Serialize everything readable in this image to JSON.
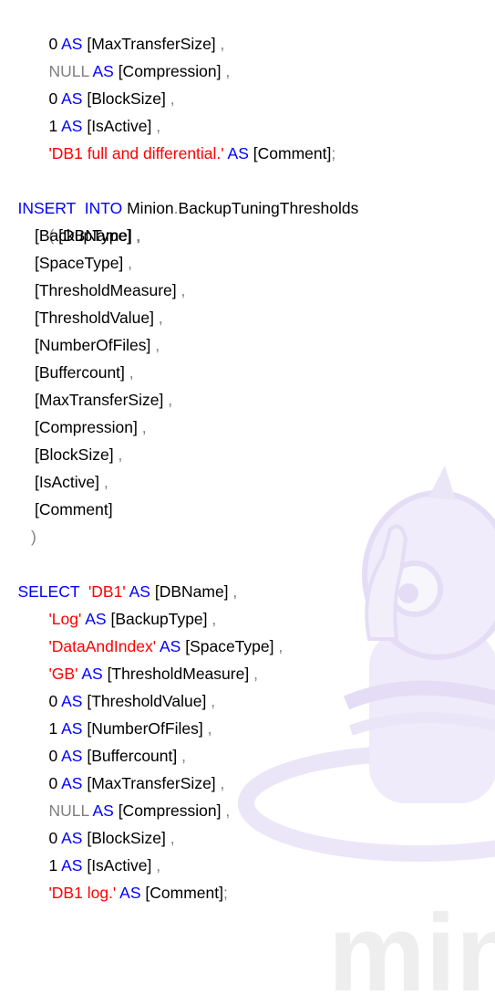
{
  "watermark": {
    "text": "minion"
  },
  "block1": {
    "select_rows": [
      {
        "value": "0",
        "alias": "[MaxTransferSize]"
      },
      {
        "value": "NULL",
        "alias": "[Compression]"
      },
      {
        "value": "0",
        "alias": "[BlockSize]"
      },
      {
        "value": "1",
        "alias": "[IsActive]"
      }
    ],
    "last_string": "'DB1 full and differential.'",
    "last_alias": "[Comment]"
  },
  "insert": {
    "keyword1": "INSERT",
    "keyword2": "INTO",
    "schema": "Minion",
    "table": "BackupTuningThresholds",
    "open_paren": "(",
    "close_paren": ")",
    "columns": [
      "[DBName]",
      "[BackupType]",
      "[SpaceType]",
      "[ThresholdMeasure]",
      "[ThresholdValue]",
      "[NumberOfFiles]",
      "[Buffercount]",
      "[MaxTransferSize]",
      "[Compression]",
      "[BlockSize]",
      "[IsActive]",
      "[Comment]"
    ]
  },
  "select": {
    "keyword": "SELECT",
    "as": "AS",
    "rows": [
      {
        "value": "'DB1'",
        "alias": "[DBName]"
      },
      {
        "value": "'Log'",
        "alias": "[BackupType]"
      },
      {
        "value": "'DataAndIndex'",
        "alias": "[SpaceType]"
      },
      {
        "value": "'GB'",
        "alias": "[ThresholdMeasure]"
      },
      {
        "value": "0",
        "alias": "[ThresholdValue]"
      },
      {
        "value": "1",
        "alias": "[NumberOfFiles]"
      },
      {
        "value": "0",
        "alias": "[Buffercount]"
      },
      {
        "value": "0",
        "alias": "[MaxTransferSize]"
      },
      {
        "value": "NULL",
        "alias": "[Compression]"
      },
      {
        "value": "0",
        "alias": "[BlockSize]"
      },
      {
        "value": "1",
        "alias": "[IsActive]"
      }
    ],
    "last_string": "'DB1 log.'",
    "last_alias": "[Comment]"
  }
}
